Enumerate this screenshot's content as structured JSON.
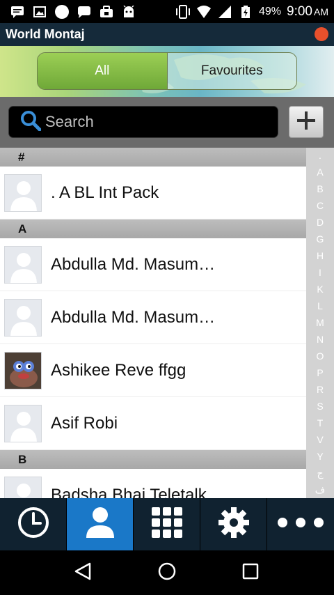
{
  "status_bar": {
    "battery": "49%",
    "time": "9:00",
    "ampm": "AM",
    "notification_icons": [
      "chat-icon",
      "image-icon",
      "circle-icon",
      "message-icon",
      "bag-icon",
      "android-icon"
    ]
  },
  "app": {
    "title": "World Montaj",
    "accent": "#e8502c"
  },
  "tabs": {
    "all_label": "All",
    "favourites_label": "Favourites",
    "selected": "All"
  },
  "search": {
    "placeholder": "Search",
    "value": ""
  },
  "contacts": {
    "sections": [
      {
        "header": "#",
        "items": [
          {
            "name": ". A BL Int Pack",
            "avatar": "default"
          }
        ]
      },
      {
        "header": "A",
        "items": [
          {
            "name": "Abdulla Md. Masum…",
            "avatar": "default"
          },
          {
            "name": "Abdulla Md. Masum…",
            "avatar": "default"
          },
          {
            "name": "Ashikee Reve ffgg",
            "avatar": "photo"
          },
          {
            "name": "Asif Robi",
            "avatar": "default"
          }
        ]
      },
      {
        "header": "B",
        "items": [
          {
            "name": "Badsha Bhai Teletalk",
            "avatar": "default"
          }
        ]
      }
    ]
  },
  "index_letters": [
    ".",
    "A",
    "B",
    "C",
    "D",
    "G",
    "H",
    "I",
    "K",
    "L",
    "M",
    "N",
    "O",
    "P",
    "R",
    "S",
    "T",
    "V",
    "Y",
    "ج",
    "ف"
  ],
  "bottom_nav": {
    "items": [
      "history-icon",
      "contacts-icon",
      "dialpad-icon",
      "settings-icon",
      "more-icon"
    ],
    "active": "contacts-icon",
    "active_color": "#1a78c8"
  },
  "system_nav": [
    "back-icon",
    "home-icon",
    "recents-icon"
  ]
}
